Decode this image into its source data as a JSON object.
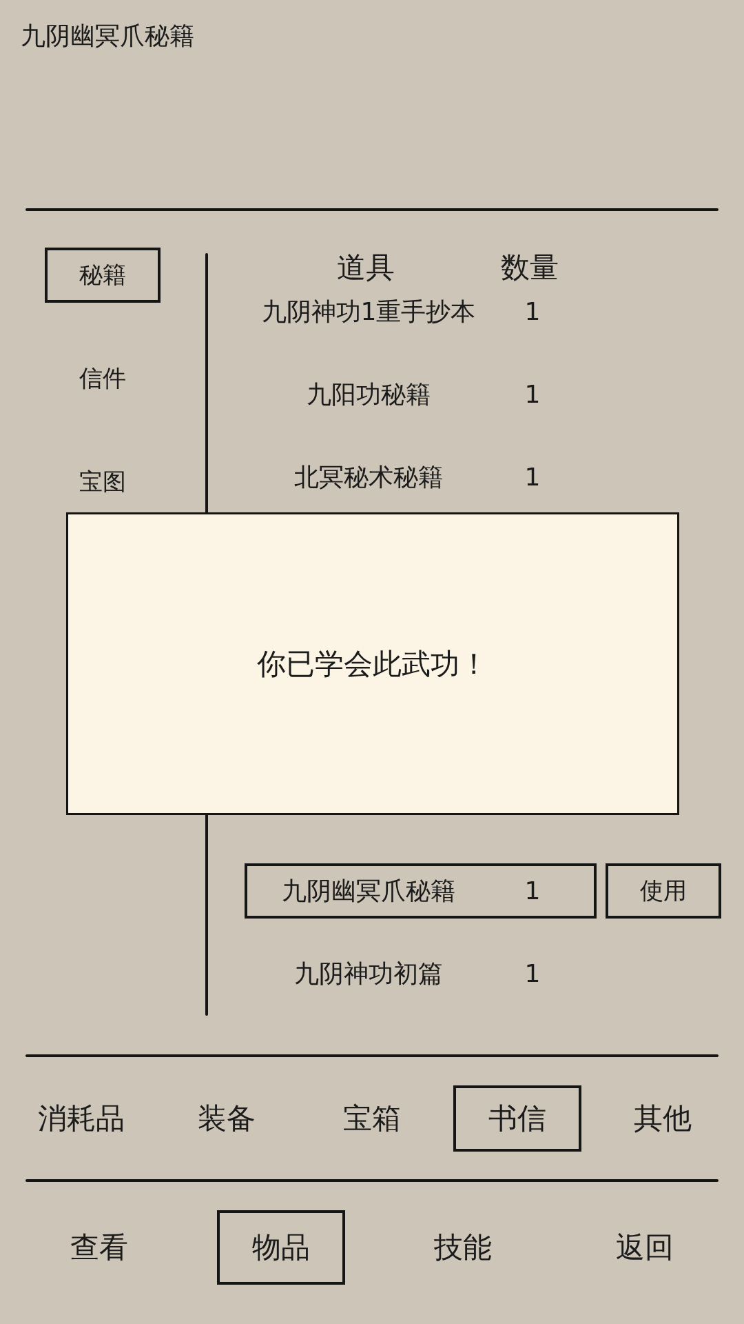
{
  "header": {
    "title": "九阴幽冥爪秘籍"
  },
  "sidebar": {
    "items": [
      {
        "label": "秘籍",
        "selected": true
      },
      {
        "label": "信件",
        "selected": false
      },
      {
        "label": "宝图",
        "selected": false
      }
    ]
  },
  "table": {
    "columns": [
      "道具",
      "数量"
    ],
    "use_button": {
      "label": "使用"
    },
    "rows_above_dialog": [
      {
        "name": "九阴神功1重手抄本",
        "count": "1",
        "selected": false
      },
      {
        "name": "九阳功秘籍",
        "count": "1",
        "selected": false
      },
      {
        "name": "北冥秘术秘籍",
        "count": "1",
        "selected": false
      }
    ],
    "rows_below_dialog": [
      {
        "name": "九阴幽冥爪秘籍",
        "count": "1",
        "selected": true
      },
      {
        "name": "九阴神功初篇",
        "count": "1",
        "selected": false
      }
    ]
  },
  "item_tabs": [
    {
      "label": "消耗品",
      "selected": false
    },
    {
      "label": "装备",
      "selected": false
    },
    {
      "label": "宝箱",
      "selected": false
    },
    {
      "label": "书信",
      "selected": true
    },
    {
      "label": "其他",
      "selected": false
    }
  ],
  "nav_tabs": [
    {
      "label": "查看",
      "selected": false
    },
    {
      "label": "物品",
      "selected": true
    },
    {
      "label": "技能",
      "selected": false
    },
    {
      "label": "返回",
      "selected": false
    }
  ],
  "dialog": {
    "message": "你已学会此武功！"
  }
}
